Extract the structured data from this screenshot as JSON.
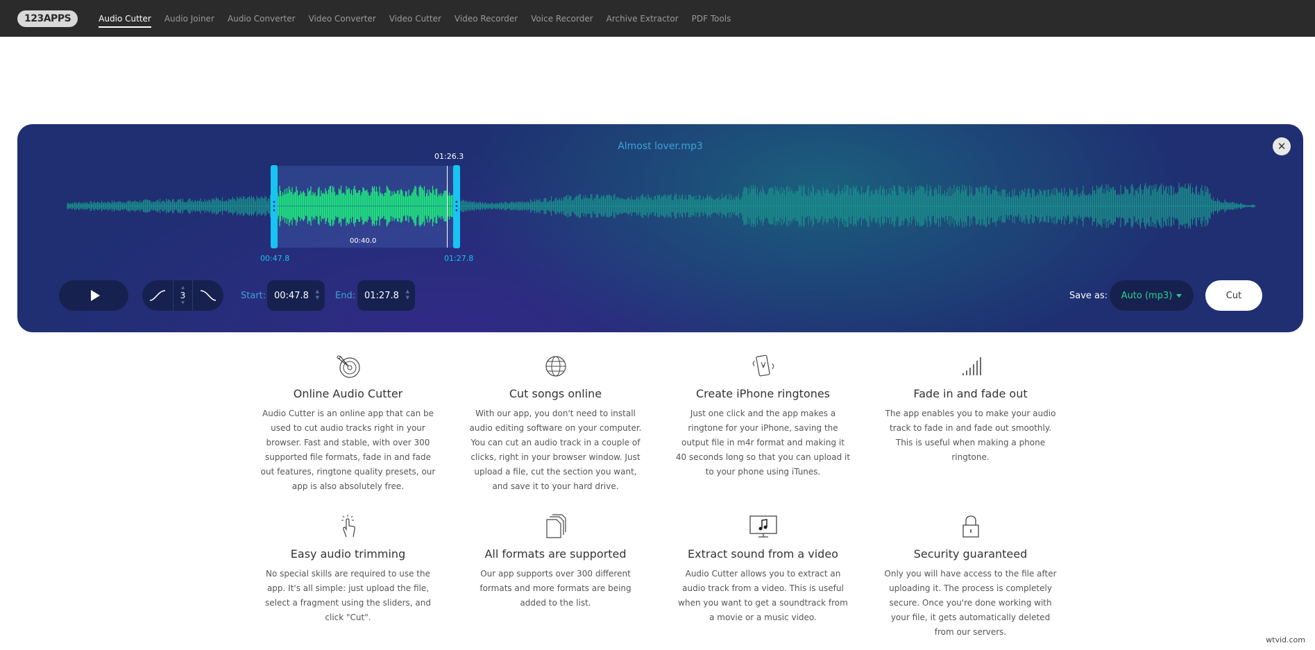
{
  "nav": {
    "logo": "123APPS",
    "links": [
      "Audio Cutter",
      "Audio Joiner",
      "Audio Converter",
      "Video Converter",
      "Video Cutter",
      "Video Recorder",
      "Voice Recorder",
      "Archive Extractor",
      "PDF Tools"
    ],
    "active_index": 0
  },
  "editor": {
    "filename": "Almost lover.mp3",
    "cursor_time": "01:26.3",
    "selection_duration": "00:40.0",
    "selection_start_label": "00:47.8",
    "selection_end_label": "01:27.8",
    "start_label": "Start:",
    "start_value": "00:47.8",
    "end_label": "End:",
    "end_value": "01:27.8",
    "fade_value": "3",
    "save_as_label": "Save as:",
    "format": "Auto (mp3)",
    "cut_label": "Cut",
    "close_symbol": "✕",
    "colors": {
      "wave_dim": "#1a8f8c",
      "wave_selected": "#1eee7e",
      "handle": "#19c3f3"
    }
  },
  "features": [
    {
      "icon": "vinyl-scissors-icon",
      "title": "Online Audio Cutter",
      "text": "Audio Cutter is an online app that can be used to cut audio tracks right in your browser. Fast and stable, with over 300 supported file formats, fade in and fade out features, ringtone quality presets, our app is also absolutely free."
    },
    {
      "icon": "globe-icon",
      "title": "Cut songs online",
      "text": "With our app, you don't need to install audio editing software on your computer. You can cut an audio track in a couple of clicks, right in your browser window. Just upload a file, cut the section you want, and save it to your hard drive."
    },
    {
      "icon": "phone-vibrate-icon",
      "title": "Create iPhone ringtones",
      "text": "Just one click and the app makes a ringtone for your iPhone, saving the output file in m4r format and making it 40 seconds long so that you can upload it to your phone using iTunes."
    },
    {
      "icon": "signal-bars-icon",
      "title": "Fade in and fade out",
      "text": "The app enables you to make your audio track to fade in and fade out smoothly. This is useful when making a phone ringtone."
    },
    {
      "icon": "pointer-click-icon",
      "title": "Easy audio trimming",
      "text": "No special skills are required to use the app. It's all simple: just upload the file, select a fragment using the sliders, and click \"Cut\"."
    },
    {
      "icon": "documents-icon",
      "title": "All formats are supported",
      "text": "Our app supports over 300 different formats and more formats are being added to the list."
    },
    {
      "icon": "monitor-music-icon",
      "title": "Extract sound from a video",
      "text": "Audio Cutter allows you to extract an audio track from a video. This is useful when you want to get a soundtrack from a movie or a music video."
    },
    {
      "icon": "padlock-icon",
      "title": "Security guaranteed",
      "text": "Only you will have access to the file after uploading it. The process is completely secure. Once you're done working with your file, it gets automatically deleted from our servers."
    }
  ],
  "watermark": "wtvid.com"
}
